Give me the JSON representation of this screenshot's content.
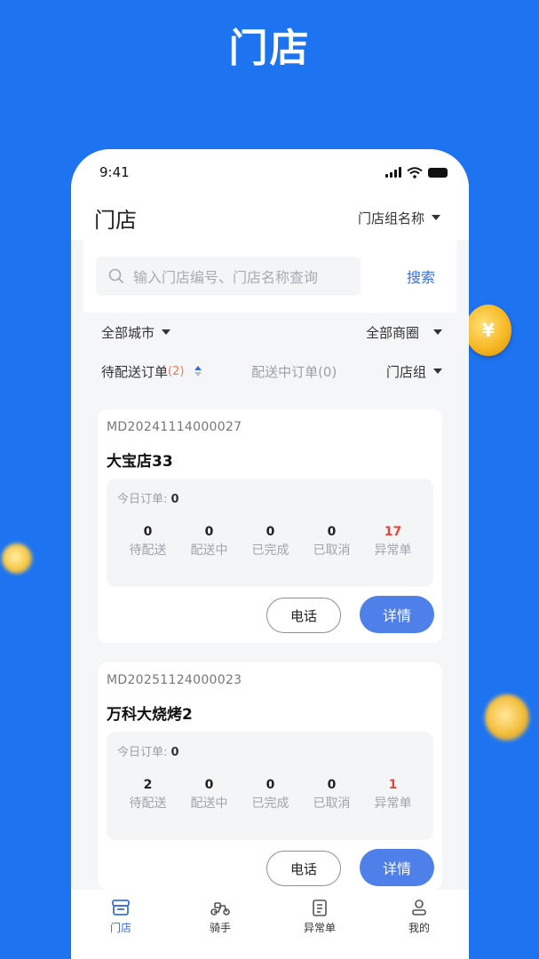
{
  "banner": {
    "title": "门店"
  },
  "status_bar": {
    "time": "9:41"
  },
  "header": {
    "title": "门店",
    "group_select": "门店组名称"
  },
  "search": {
    "placeholder": "输入门店编号、门店名称查询",
    "button": "搜索"
  },
  "filters": {
    "city": "全部城市",
    "district": "全部商圈",
    "tab_pending_label": "待配送订单",
    "tab_pending_count": "(2)",
    "tab_delivering": "配送中订单(0)",
    "store_group": "门店组"
  },
  "stores": [
    {
      "id": "MD20241114000027",
      "name": "大宝店33",
      "today_label": "今日订单:",
      "today_count": "0",
      "stats": [
        {
          "value": "0",
          "label": "待配送"
        },
        {
          "value": "0",
          "label": "配送中"
        },
        {
          "value": "0",
          "label": "已完成"
        },
        {
          "value": "0",
          "label": "已取消"
        },
        {
          "value": "17",
          "label": "异常单"
        }
      ],
      "call": "电话",
      "detail": "详情"
    },
    {
      "id": "MD20251124000023",
      "name": "万科大烧烤2",
      "today_label": "今日订单:",
      "today_count": "0",
      "stats": [
        {
          "value": "2",
          "label": "待配送"
        },
        {
          "value": "0",
          "label": "配送中"
        },
        {
          "value": "0",
          "label": "已完成"
        },
        {
          "value": "0",
          "label": "已取消"
        },
        {
          "value": "1",
          "label": "异常单"
        }
      ],
      "call": "电话",
      "detail": "详情"
    }
  ],
  "tabbar": [
    {
      "label": "门店",
      "icon": "store-icon"
    },
    {
      "label": "骑手",
      "icon": "scooter-icon"
    },
    {
      "label": "异常单",
      "icon": "clipboard-icon"
    },
    {
      "label": "我的",
      "icon": "user-icon"
    }
  ],
  "colors": {
    "brand": "#1E74F0",
    "accent": "#4F7FE8",
    "alert": "#E8443A"
  }
}
